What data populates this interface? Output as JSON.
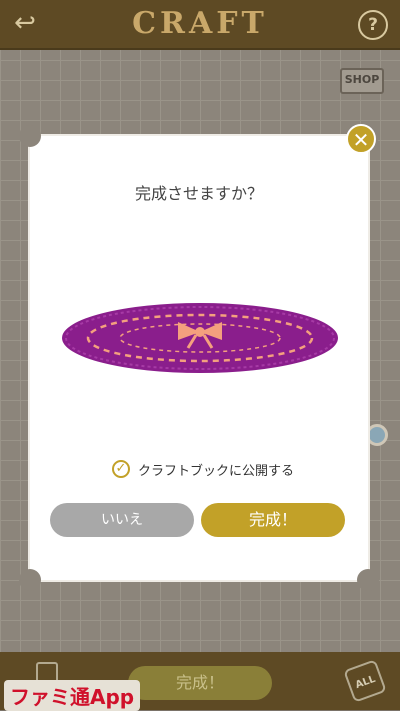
{
  "header": {
    "title": "CRAFT",
    "back_icon": "back-arrow-icon",
    "help_label": "?"
  },
  "shop_label": "SHOP",
  "dialog": {
    "question": "完成させますか？",
    "checkbox_label": "クラフトブックに公開する",
    "checkbox_checked": true,
    "cancel_label": "いいえ",
    "confirm_label": "完成！",
    "close_icon": "close-icon"
  },
  "footer": {
    "complete_label": "完成！",
    "all_label": "ALL"
  },
  "watermark": "ファミ通App",
  "colors": {
    "accent": "#c2a128",
    "header_brown": "#5e4a24",
    "item_purple": "#8a1e8c",
    "item_pink": "#f4a07e"
  }
}
